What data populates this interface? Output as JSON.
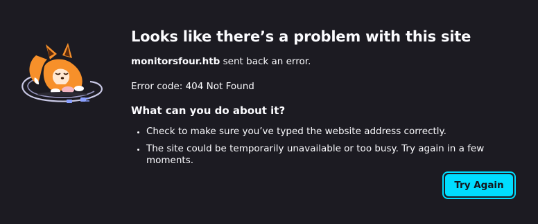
{
  "error": {
    "title": "Looks like there’s a problem with this site",
    "host": "monitorsfour.htb",
    "host_suffix": " sent back an error.",
    "code_line": "Error code: 404 Not Found",
    "help_heading": "What can you do about it?",
    "suggestions": [
      "Check to make sure you’ve typed the website address correctly.",
      "The site could be temporarily unavailable or too busy. Try again in a few moments."
    ]
  },
  "actions": {
    "try_again_label": "Try Again"
  },
  "illustration": {
    "icon": "fox-unplugged-cable-icon"
  },
  "colors": {
    "background": "#1c1b22",
    "text": "#fbfbfe",
    "accent": "#00ddff",
    "fox_orange": "#f7902a"
  }
}
